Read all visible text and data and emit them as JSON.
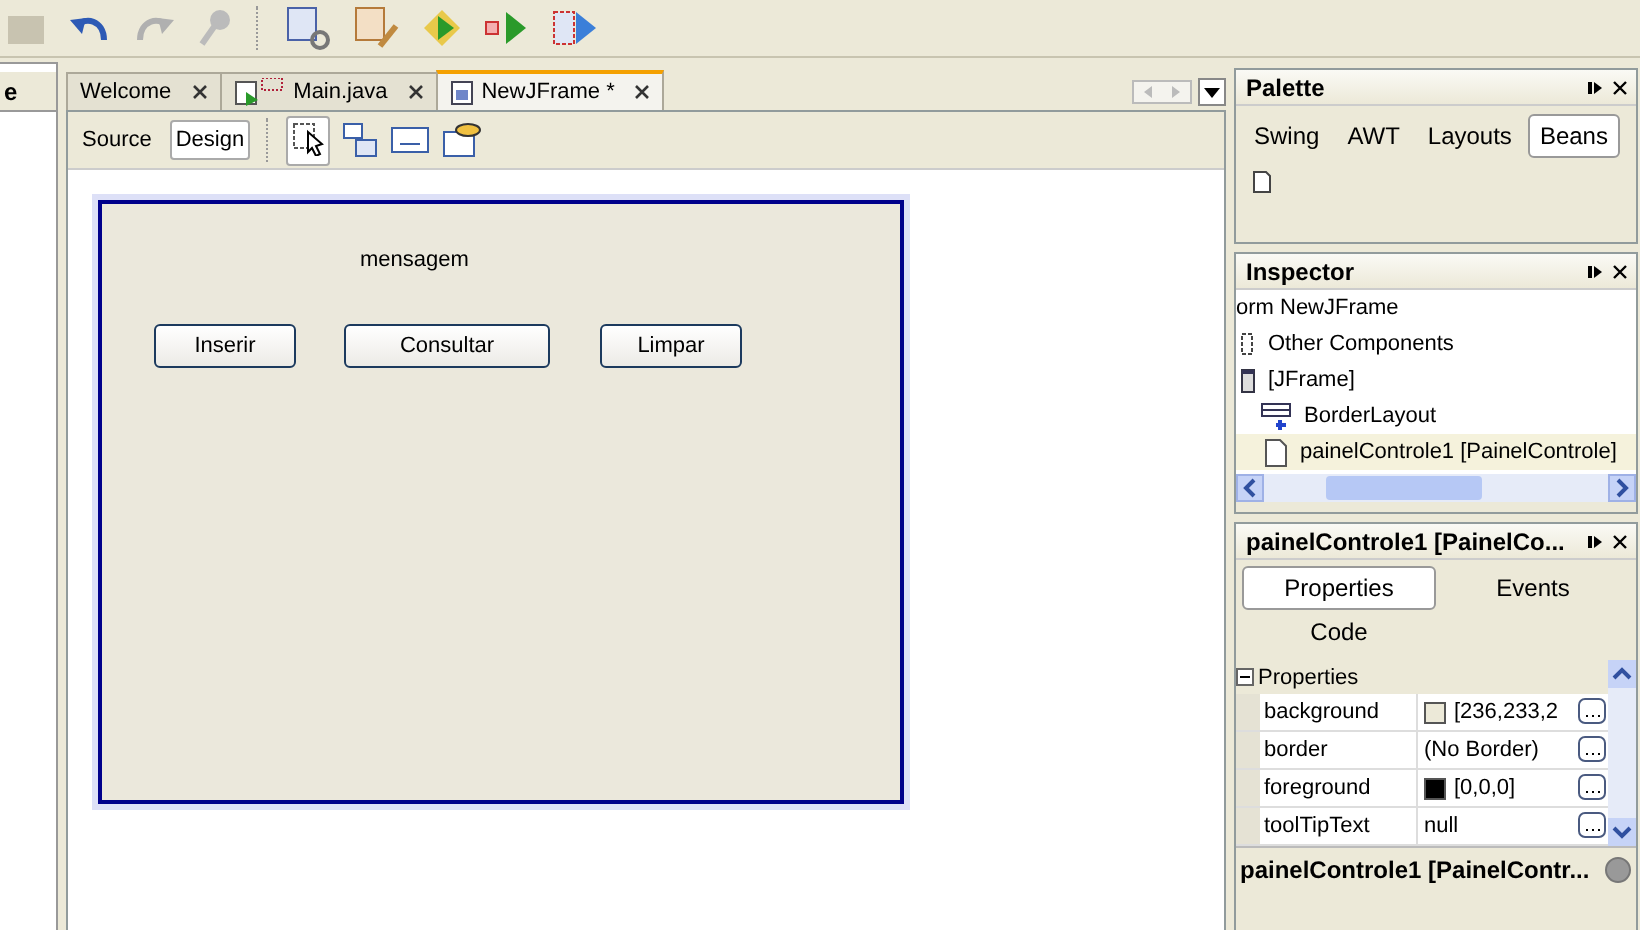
{
  "left_panel": {
    "title": "e"
  },
  "editor_tabs": [
    {
      "label": "Welcome",
      "kind": "plain",
      "selected": false
    },
    {
      "label": "Main.java",
      "kind": "java",
      "selected": false
    },
    {
      "label": "NewJFrame *",
      "kind": "form",
      "selected": true
    }
  ],
  "view_toggle": [
    {
      "label": "Source",
      "selected": false
    },
    {
      "label": "Design",
      "selected": true
    }
  ],
  "form": {
    "label": "mensagem",
    "buttons": [
      "Inserir",
      "Consultar",
      "Limpar"
    ]
  },
  "palette": {
    "title": "Palette",
    "tabs": [
      {
        "label": "Swing",
        "selected": false
      },
      {
        "label": "AWT",
        "selected": false
      },
      {
        "label": "Layouts",
        "selected": false
      },
      {
        "label": "Beans",
        "selected": true
      }
    ]
  },
  "inspector": {
    "title": "Inspector",
    "tree": [
      {
        "label": "orm NewJFrame",
        "selected": false,
        "children": [
          {
            "label": "Other Components",
            "selected": false
          },
          {
            "label": "[JFrame]",
            "selected": false,
            "children": [
              {
                "label": "BorderLayout",
                "selected": false
              },
              {
                "label": "painelControle1 [PainelControle]",
                "selected": true
              }
            ]
          }
        ]
      }
    ]
  },
  "properties": {
    "title": "painelControle1 [PainelCo...",
    "tabs": [
      {
        "label": "Properties",
        "selected": true
      },
      {
        "label": "Events",
        "selected": false
      },
      {
        "label": "Code",
        "selected": false
      }
    ],
    "section": {
      "label": "Properties",
      "expanded": true
    },
    "rows": [
      {
        "name": "background",
        "value": "[236,233,2",
        "color": "#ece9d8"
      },
      {
        "name": "border",
        "value": "(No Border)"
      },
      {
        "name": "foreground",
        "value": "[0,0,0]",
        "color": "#000000"
      },
      {
        "name": "toolTipText",
        "value": "null"
      }
    ],
    "help_title": "painelControle1 [PainelContr..."
  }
}
